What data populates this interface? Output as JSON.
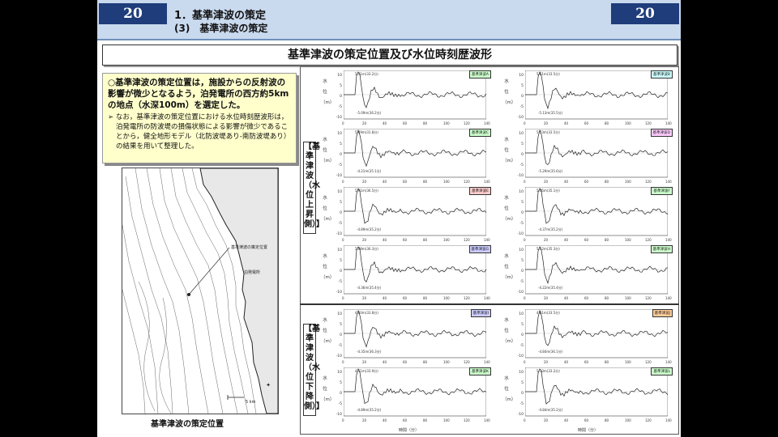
{
  "header": {
    "page_left": "20",
    "page_right": "20",
    "section1": "1．基準津波の策定",
    "section2": "(3)　基準津波の策定"
  },
  "title": "基準津波の策定位置及び水位時刻歴波形",
  "note": {
    "main": "○基準津波の策定位置は，施設からの反射波の影響が微少となるよう，泊発電所の西方約5kmの地点（水深100m）を選定した。",
    "sub": "➢ なお，基準津波の策定位置における水位時刻歴波形は，泊発電所の防波堤の損傷状態による影響が微少であることから，健全地形モデル（北防波堤あり-南防波堤あり）の結果を用いて整理した。"
  },
  "map": {
    "caption": "基準津波の策定位置",
    "label_point": "基準津波の策定位置",
    "label_plant": "泊発電所",
    "scale": "5 km"
  },
  "side_labels": {
    "rise": "【基準津波（水位上昇側）】",
    "fall": "【基準津波（水位下降側）】"
  },
  "axis": {
    "ylabel": "水位（m）",
    "xlabel": "時間（分）",
    "yticks": [
      "10",
      "5",
      "0",
      "-5",
      "-10"
    ],
    "xticks": [
      "0",
      "20",
      "40",
      "60",
      "80",
      "100",
      "120",
      "140"
    ]
  },
  "waves": [
    {
      "tag": "基準津波A",
      "max": "5.41m(33.2分)",
      "min": "-5.09m(36.2分)",
      "tagcolor": "#ccffcc"
    },
    {
      "tag": "基準津波B",
      "max": "5.61m(33.5分)",
      "min": "-5.13m(35.5分)",
      "tagcolor": "#ccffff"
    },
    {
      "tag": "基準津波C",
      "max": "5.49m(31.8分)",
      "min": "-4.21m(35.1分)",
      "tagcolor": "#ccffcc"
    },
    {
      "tag": "基準津波D",
      "max": "5.73m(33.5分)",
      "min": "-5.29m(35.6分)",
      "tagcolor": "#ffccff"
    },
    {
      "tag": "基準津波E",
      "max": "5.91m(36.5分)",
      "min": "-4.89m(35.2分)",
      "tagcolor": "#ffcccc"
    },
    {
      "tag": "基準津波F",
      "max": "5.85m(35.1分)",
      "min": "-4.37m(35.2分)",
      "tagcolor": "#ccffcc"
    },
    {
      "tag": "基準津波G",
      "max": "5.89m(36.3分)",
      "min": "-4.36m(35.4分)",
      "tagcolor": "#ccccff"
    },
    {
      "tag": "基準津波H",
      "max": "5.52m(35.3分)",
      "min": "-4.22m(35.4分)",
      "tagcolor": "#ccffcc"
    },
    {
      "tag": "基準津波I",
      "max": "4.30m(33.8分)",
      "min": "-4.35m(36.3分)",
      "tagcolor": "#ccccff"
    },
    {
      "tag": "基準津波J",
      "max": "4.81m(33.5分)",
      "min": "-4.84m(36.1分)",
      "tagcolor": "#ffcc99"
    },
    {
      "tag": "基準津波K",
      "max": "4.51m(33.9分)",
      "min": "-4.89m(35.2分)",
      "tagcolor": "#ccffcc"
    },
    {
      "tag": "基準津波L",
      "max": "5.13m(33.2分)",
      "min": "-4.84m(35.2分)",
      "tagcolor": "#ccffcc"
    }
  ]
}
